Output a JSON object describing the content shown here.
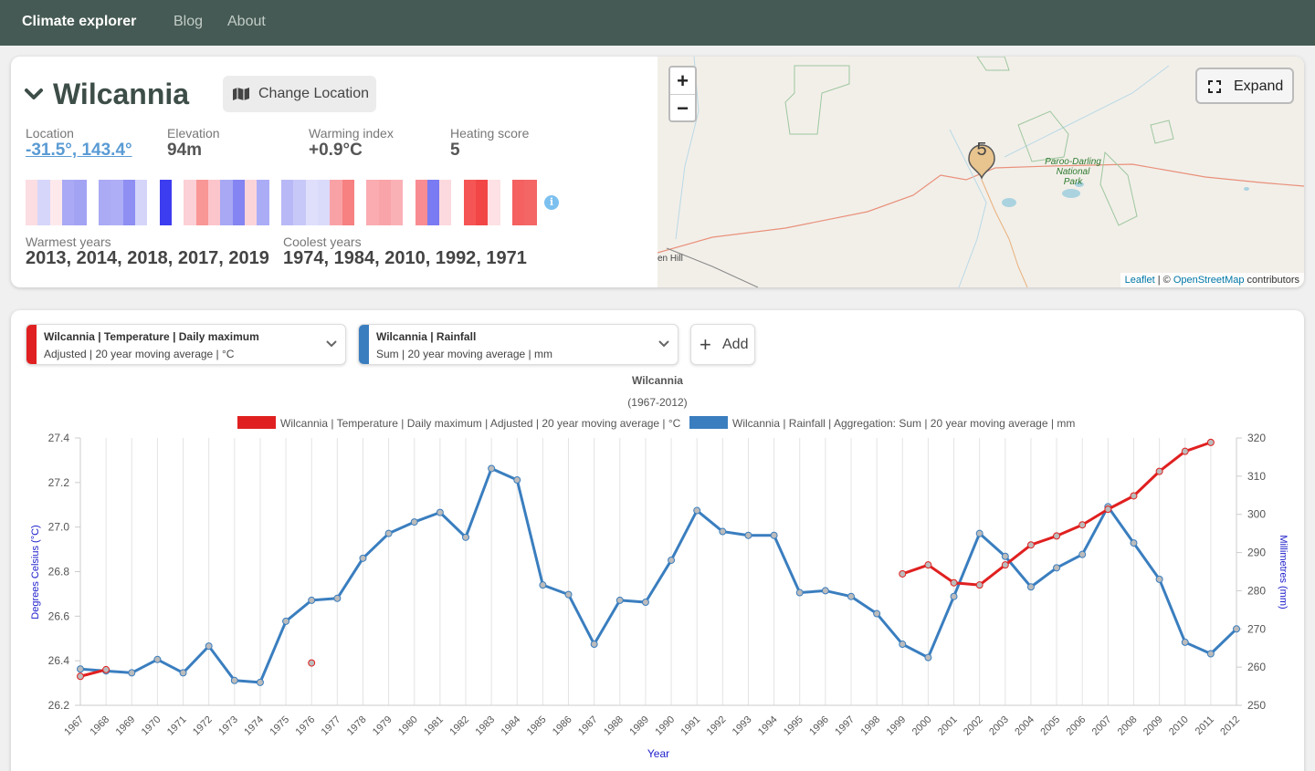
{
  "nav": {
    "brand": "Climate explorer",
    "links": [
      "Blog",
      "About"
    ]
  },
  "location": {
    "name": "Wilcannia",
    "change_label": "Change Location",
    "stats": [
      {
        "label": "Location",
        "value": "-31.5°, 143.4°"
      },
      {
        "label": "Elevation",
        "value": "94m"
      },
      {
        "label": "Warming index",
        "value": "+0.9°C"
      },
      {
        "label": "Heating score",
        "value": "5"
      }
    ],
    "warmest_label": "Warmest years",
    "warmest_value": "2013, 2014, 2018, 2017, 2019",
    "coolest_label": "Coolest years",
    "coolest_value": "1974, 1984, 2010, 1992, 1971",
    "info_icon": "i",
    "stripe_colors": [
      "#fbdde2",
      "#d6d6fa",
      "#fde9ec",
      "#a9a9f5",
      "#a3a3f4",
      "#ffffff",
      "#aaaaf5",
      "#aeaef6",
      "#8e8ef3",
      "#d5d5fa",
      "#ffffff",
      "#3c3cf0",
      "#ffffff",
      "#fbd0d6",
      "#f99696",
      "#fbc5cb",
      "#a8a8f5",
      "#8484f2",
      "#fbd4da",
      "#abacf6",
      "#ffffff",
      "#b8b8f7",
      "#c8c8f8",
      "#dfdffb",
      "#dadafb",
      "#f9a2a6",
      "#f78080",
      "#ffffff",
      "#faacb1",
      "#f9a4a8",
      "#fab1b6",
      "#ffffff",
      "#f98c92",
      "#7a7af2",
      "#fcd9de",
      "#ffffff",
      "#f65555",
      "#f24646",
      "#fde1e4",
      "#ffffff",
      "#f56060",
      "#f46666"
    ]
  },
  "map": {
    "zoom_in": "+",
    "zoom_out": "−",
    "expand_label": "Expand",
    "marker_label": "5",
    "park_label": [
      "Paroo-Darling",
      "National",
      "Park"
    ],
    "place_label": "en Hill",
    "attribution_leaflet": "Leaflet",
    "attribution_sep": " | © ",
    "attribution_osm": "OpenStreetMap",
    "attribution_tail": " contributors"
  },
  "selectors": [
    {
      "title": "Wilcannia | Temperature | Daily maximum",
      "subtitle": "Adjusted | 20 year moving average | °C",
      "color": "#e02020"
    },
    {
      "title": "Wilcannia | Rainfall",
      "subtitle": "Sum | 20 year moving average | mm",
      "color": "#3a7ebf"
    }
  ],
  "add_label": "Add",
  "chart_data": {
    "type": "line",
    "title": "Wilcannia",
    "subtitle": "(1967-2012)",
    "xlabel": "Year",
    "ylabel_left": "Degrees Celsius (°C)",
    "ylabel_right": "Millimetres (mm)",
    "ylim_left": [
      26.2,
      27.4
    ],
    "ylim_right": [
      250,
      320
    ],
    "yticks_left": [
      "27.4",
      "27.2",
      "27.0",
      "26.8",
      "26.6",
      "26.4",
      "26.2"
    ],
    "yticks_right": [
      "320",
      "310",
      "300",
      "290",
      "280",
      "270",
      "260",
      "250"
    ],
    "x": [
      1967,
      1968,
      1969,
      1970,
      1971,
      1972,
      1973,
      1974,
      1975,
      1976,
      1977,
      1978,
      1979,
      1980,
      1981,
      1982,
      1983,
      1984,
      1985,
      1986,
      1987,
      1988,
      1989,
      1990,
      1991,
      1992,
      1993,
      1994,
      1995,
      1996,
      1997,
      1998,
      1999,
      2000,
      2001,
      2002,
      2003,
      2004,
      2005,
      2006,
      2007,
      2008,
      2009,
      2010,
      2011,
      2012
    ],
    "series": [
      {
        "name": "Wilcannia | Temperature | Daily maximum | Adjusted | 20 year moving average | °C",
        "axis": "left",
        "color": "#e02020",
        "values": [
          26.33,
          26.36,
          null,
          null,
          null,
          null,
          null,
          null,
          null,
          26.39,
          null,
          null,
          null,
          null,
          null,
          null,
          null,
          null,
          null,
          null,
          null,
          null,
          null,
          null,
          null,
          null,
          null,
          null,
          null,
          null,
          null,
          null,
          26.79,
          26.83,
          26.75,
          26.74,
          26.83,
          26.92,
          26.96,
          27.01,
          27.08,
          27.14,
          27.25,
          27.34,
          27.38,
          null
        ]
      },
      {
        "name": "Wilcannia | Rainfall | Aggregation: Sum | 20 year moving average | mm",
        "axis": "right",
        "color": "#3a7ebf",
        "values": [
          259.5,
          259.0,
          258.5,
          262.0,
          258.5,
          265.5,
          256.5,
          256.0,
          272.0,
          277.5,
          278.0,
          288.5,
          295.0,
          298.0,
          300.5,
          294.0,
          312.0,
          309.0,
          281.5,
          279.0,
          266.0,
          277.5,
          277.0,
          288.0,
          301.0,
          295.5,
          294.5,
          294.5,
          279.5,
          280.0,
          278.5,
          274.0,
          266.0,
          262.5,
          278.5,
          295.0,
          289.0,
          281.0,
          286.0,
          289.5,
          302.0,
          292.5,
          283.0,
          266.5,
          263.5,
          270.0
        ]
      }
    ]
  }
}
